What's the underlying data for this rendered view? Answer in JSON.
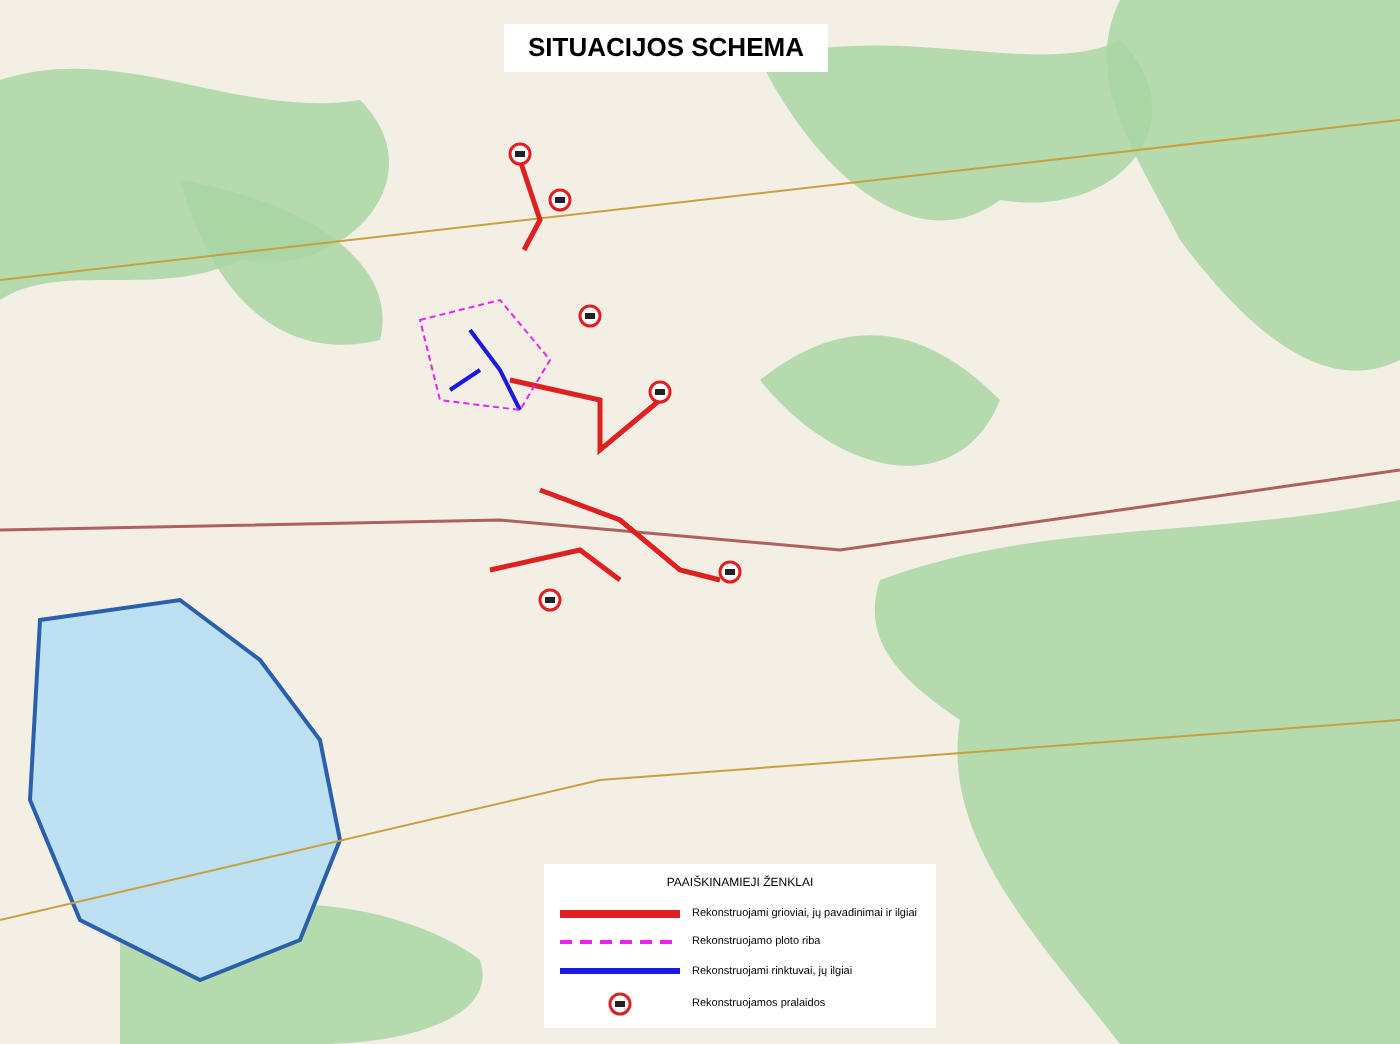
{
  "title": "SITUACIJOS SCHEMA",
  "legend": {
    "heading": "PAAIŠKINAMIEJI ŽENKLAI",
    "items": [
      {
        "kind": "red-line",
        "label": "Rekonstruojami grioviai, jų pavadinimai ir ilgiai"
      },
      {
        "kind": "pink-dashed",
        "label": "Rekonstruojamo ploto riba"
      },
      {
        "kind": "blue-line",
        "label": "Rekonstruojami rinktuvai, jų ilgiai"
      },
      {
        "kind": "culvert",
        "label": "Rekonstruojamos pralaidos"
      }
    ]
  }
}
